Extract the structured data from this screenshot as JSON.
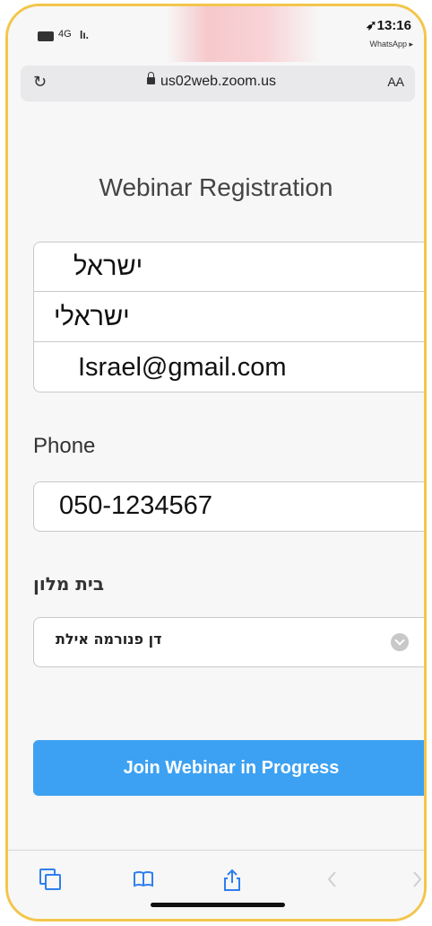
{
  "status_bar": {
    "network": "4G",
    "signal": "lı.",
    "time": "13:16",
    "back_app": "WhatsApp ▸"
  },
  "browser": {
    "url": "us02web.zoom.us",
    "text_size_label": "AA"
  },
  "form": {
    "title": "Webinar Registration",
    "first_name_value": "ישראל",
    "last_name_value": "ישראלי",
    "email_value": "Israel@gmail.com",
    "phone_label": "Phone",
    "phone_value": "050-1234567",
    "hotel_label": "בית מלון",
    "hotel_value": "דן פנורמה אילת",
    "submit_label": "Join Webinar in Progress"
  },
  "icons": {
    "reload": "reload-icon",
    "lock": "lock-icon",
    "tabs": "tabs-icon",
    "bookmarks": "book-icon",
    "share": "share-icon",
    "back": "back-icon",
    "forward": "forward-icon"
  },
  "colors": {
    "accent": "#3ca1f2",
    "toolbar_icon": "#2f7fef",
    "frame": "#f3c64b"
  }
}
